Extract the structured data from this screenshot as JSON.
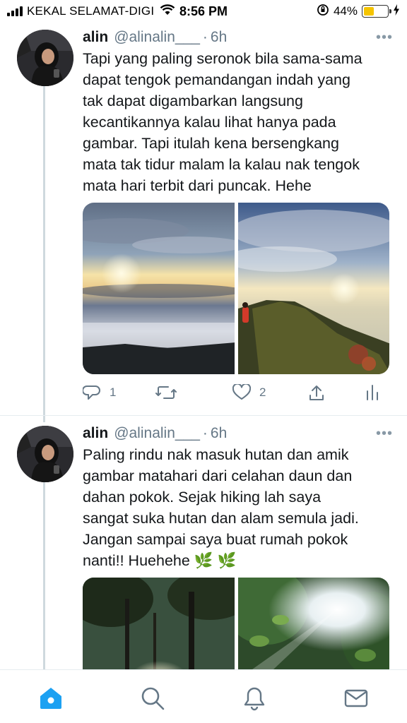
{
  "status_bar": {
    "carrier": "KEKAL SELAMAT-DIGI",
    "time": "8:56 PM",
    "battery_percent": "44%",
    "battery_level": 0.44,
    "icons": [
      "signal-icon",
      "wifi-icon",
      "orientation-lock-icon",
      "battery-icon",
      "charging-icon"
    ]
  },
  "tweets": [
    {
      "name": "alin",
      "handle": "@alinalin___",
      "separator": "·",
      "time": "6h",
      "more": "•••",
      "text": "Tapi yang paling seronok bila sama-sama\ndapat tengok pemandangan indah yang\ntak dapat digambarkan langsung\nkecantikannya kalau lihat hanya pada\ngambar. Tapi itulah kena bersengkang\nmata tak tidur malam la kalau nak tengok\nmata hari terbit dari puncak. Hehe",
      "images": [
        "sunrise-above-clouds-photo",
        "hikers-on-ridge-sunrise-photo"
      ],
      "reply_count": "1",
      "retweet_count": "",
      "like_count": "2"
    },
    {
      "name": "alin",
      "handle": "@alinalin___",
      "separator": "·",
      "time": "6h",
      "more": "•••",
      "text": "Paling rindu nak masuk hutan dan amik\ngambar matahari dari celahan daun dan\ndahan pokok. Sejak hiking lah saya\nsangat suka hutan dan alam semula jadi.\nJangan sampai saya buat rumah pokok\nnanti!! Huehehe 🌿 🌿",
      "images": [
        "forest-canopy-sunlight-photo",
        "sun-through-leaves-photo"
      ]
    }
  ],
  "bottom_nav": [
    "home-icon",
    "search-icon",
    "notifications-icon",
    "messages-icon"
  ],
  "colors": {
    "accent": "#1da1f2",
    "secondary_text": "#657786",
    "battery": "#f5c400"
  }
}
